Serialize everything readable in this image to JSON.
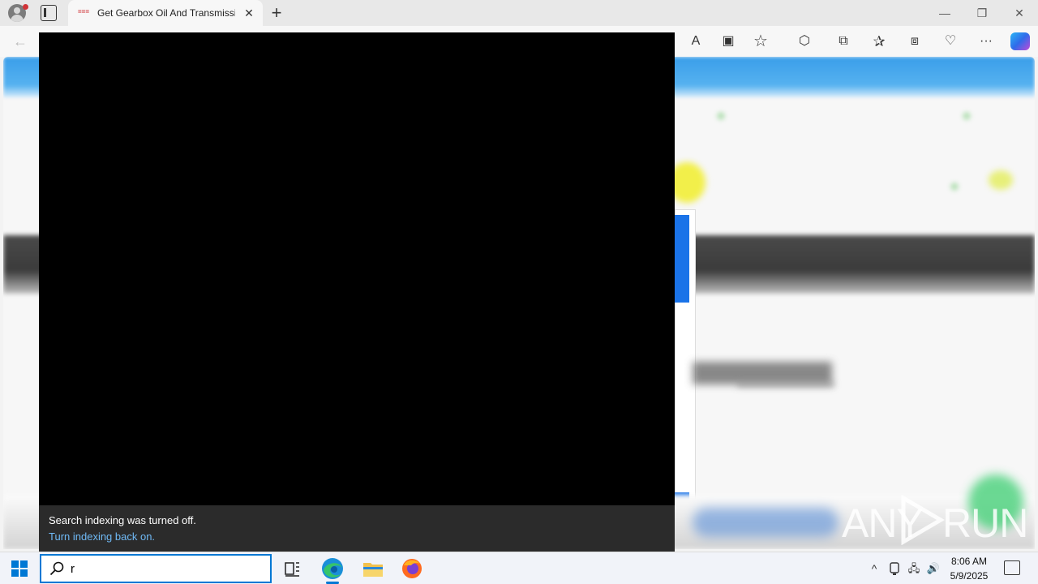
{
  "browser": {
    "tab": {
      "title": "Get Gearbox Oil And Transmission",
      "favicon_text": "==="
    },
    "new_tab_symbol": "+",
    "window_controls": {
      "minimize": "—",
      "restore": "❐",
      "close": "✕"
    },
    "toolbar": {
      "back_symbol": "←",
      "read_aloud_symbol": "A",
      "immersive_symbol": "▣",
      "favorite_symbol": "☆",
      "extensions_symbol": "⬡",
      "split_symbol": "⧉",
      "favorites_symbol": "✰",
      "collections_symbol": "⧈",
      "performance_symbol": "♡",
      "more_symbol": "···"
    }
  },
  "search_panel": {
    "notice_text": "Search indexing was turned off.",
    "notice_link": "Turn indexing back on."
  },
  "taskbar": {
    "search_value": "r",
    "clock_time": "8:06 AM",
    "clock_date": "5/9/2025",
    "tray": {
      "chevron": "^",
      "network": "🖧",
      "volume": "🔊"
    }
  },
  "watermark": {
    "left": "ANY",
    "right": "RUN"
  }
}
